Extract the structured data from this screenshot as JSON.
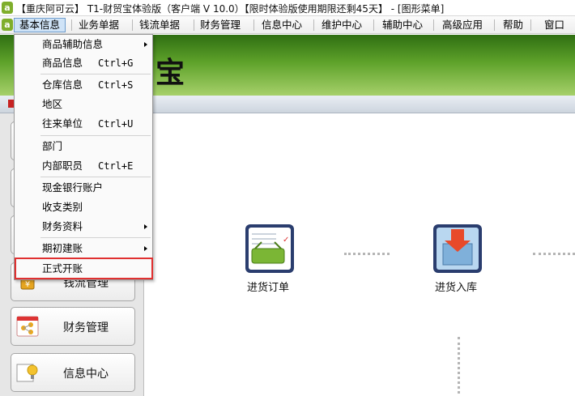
{
  "window": {
    "title": "【重庆阿可云】 T1-财贸宝体验版（客户端 V 10.0）【限时体验版使用期限还剩45天】 - [图形菜单]"
  },
  "menubar": {
    "items": [
      "基本信息",
      "业务单据",
      "钱流单据",
      "财务管理",
      "信息中心",
      "维护中心",
      "辅助中心",
      "高级应用",
      "帮助",
      "窗口"
    ]
  },
  "banner": {
    "text": "宝"
  },
  "dropdown": {
    "items": [
      {
        "label": "商品辅助信息",
        "shortcut": "",
        "submenu": true
      },
      {
        "label": "商品信息",
        "shortcut": "Ctrl+G",
        "submenu": false
      },
      {
        "label": "仓库信息",
        "shortcut": "Ctrl+S",
        "submenu": false
      },
      {
        "label": "地区",
        "shortcut": "",
        "submenu": false
      },
      {
        "label": "往来单位",
        "shortcut": "Ctrl+U",
        "submenu": false
      },
      {
        "label": "部门",
        "shortcut": "",
        "submenu": false
      },
      {
        "label": "内部职员",
        "shortcut": "Ctrl+E",
        "submenu": false
      },
      {
        "label": "现金银行账户",
        "shortcut": "",
        "submenu": false
      },
      {
        "label": "收支类别",
        "shortcut": "",
        "submenu": false
      },
      {
        "label": "财务资料",
        "shortcut": "",
        "submenu": true
      },
      {
        "label": "期初建账",
        "shortcut": "",
        "submenu": true
      },
      {
        "label": "正式开账",
        "shortcut": "",
        "submenu": false
      }
    ]
  },
  "sidebar": {
    "buttons": [
      "钱流管理",
      "财务管理",
      "信息中心"
    ]
  },
  "flow": {
    "nodes": [
      "进货订单",
      "进货入库"
    ]
  },
  "colors": {
    "accent_green": "#5ea22a",
    "highlight_red": "#e03030",
    "menu_active": "#cfe3f7"
  }
}
